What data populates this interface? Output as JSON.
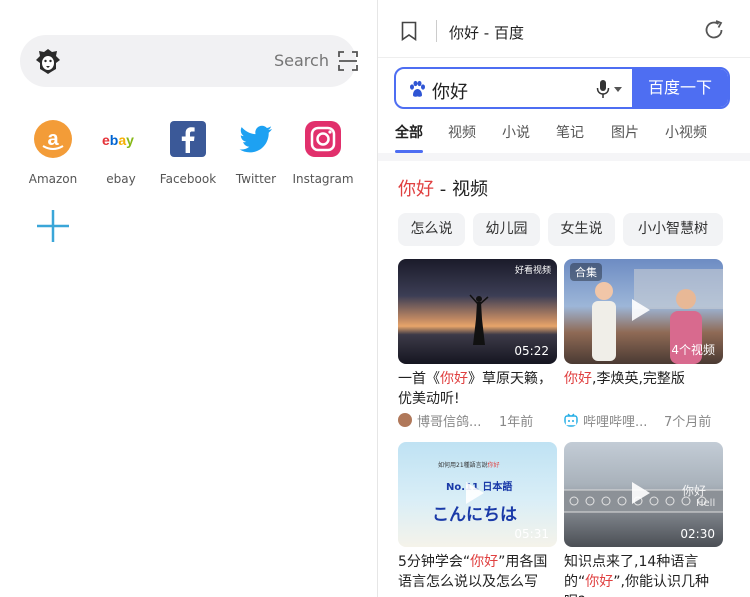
{
  "left": {
    "search": {
      "placeholder": "Search",
      "logo_icon": "lion-icon",
      "scan_icon": "scan-icon"
    },
    "shortcuts": [
      {
        "label": "Amazon",
        "icon": "amazon-icon",
        "color": "#f39c38"
      },
      {
        "label": "ebay",
        "icon": "ebay-icon",
        "color": "#e53238"
      },
      {
        "label": "Facebook",
        "icon": "facebook-icon",
        "color": "#3b5998"
      },
      {
        "label": "Twitter",
        "icon": "twitter-icon",
        "color": "#1da1f2"
      },
      {
        "label": "Instagram",
        "icon": "instagram-icon",
        "color": "#e1306c"
      }
    ],
    "add_icon": "plus-icon"
  },
  "right": {
    "page_title": "你好 - 百度",
    "query": "你好",
    "search_button": "百度一下",
    "tabs": [
      "全部",
      "视频",
      "小说",
      "笔记",
      "图片",
      "小视频"
    ],
    "section": {
      "highlight": "你好",
      "suffix": " - 视频"
    },
    "chips": [
      "怎么说",
      "幼儿园",
      "女生说",
      "小小智慧树"
    ],
    "videos": [
      {
        "title_pre": "一首《",
        "title_hl": "你好",
        "title_post": "》草原天籁，优美动听!",
        "duration": "05:22",
        "watermark": "好看视频",
        "source": "博哥信鸽...",
        "time": "1年前"
      },
      {
        "title_pre": "",
        "title_hl": "你好",
        "title_post": ",李焕英,完整版",
        "badge": "合集",
        "count": "4个视频",
        "source": "哔哩哔哩...",
        "time": "7个月前"
      },
      {
        "title_pre": "5分钟学会“",
        "title_hl": "你好",
        "title_post": "”用各国语言怎么说以及怎么写",
        "duration": "05:31",
        "overlay_top": "如何用21種語言說",
        "overlay_hl": "你好",
        "overlay_mid": "No.11 日本語",
        "overlay_big": "こんにちは"
      },
      {
        "title_pre": "知识点来了,14种语言的“",
        "title_hl": "你好",
        "title_post": "”,你能认识几种呢?",
        "duration": "02:30",
        "overlay_a": "你好",
        "overlay_b": "Hell"
      }
    ],
    "colors": {
      "accent": "#4e6ef2",
      "highlight": "#e04040"
    }
  }
}
